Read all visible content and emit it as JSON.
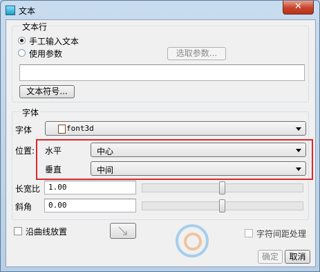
{
  "window": {
    "title": "文本",
    "close_label": "✕"
  },
  "text_line": {
    "group_label": "文本行",
    "radio_manual": {
      "label": "手工输入文本",
      "selected": true
    },
    "radio_param": {
      "label": "使用参数",
      "selected": false
    },
    "select_param_button": "选取参数...",
    "text_value": "",
    "text_symbol_button": "文本符号..."
  },
  "font": {
    "group_label": "字体",
    "font_label": "字体",
    "font_value": "font3d",
    "position_label": "位置:",
    "horizontal_label": "水平",
    "horizontal_value": "中心",
    "vertical_label": "垂直",
    "vertical_value": "中间",
    "aspect_label": "长宽比",
    "aspect_value": "1.00",
    "slant_label": "斜角",
    "slant_value": "0.00"
  },
  "options": {
    "along_curve_label": "沿曲线放置",
    "along_curve_checked": false,
    "char_spacing_label": "字符间距处理",
    "char_spacing_checked": false
  },
  "footer": {
    "ok_button": "确定",
    "cancel_button": "取消"
  },
  "colors": {
    "highlight_box": "#d9262c",
    "title_bar": "#bfd6ea"
  }
}
